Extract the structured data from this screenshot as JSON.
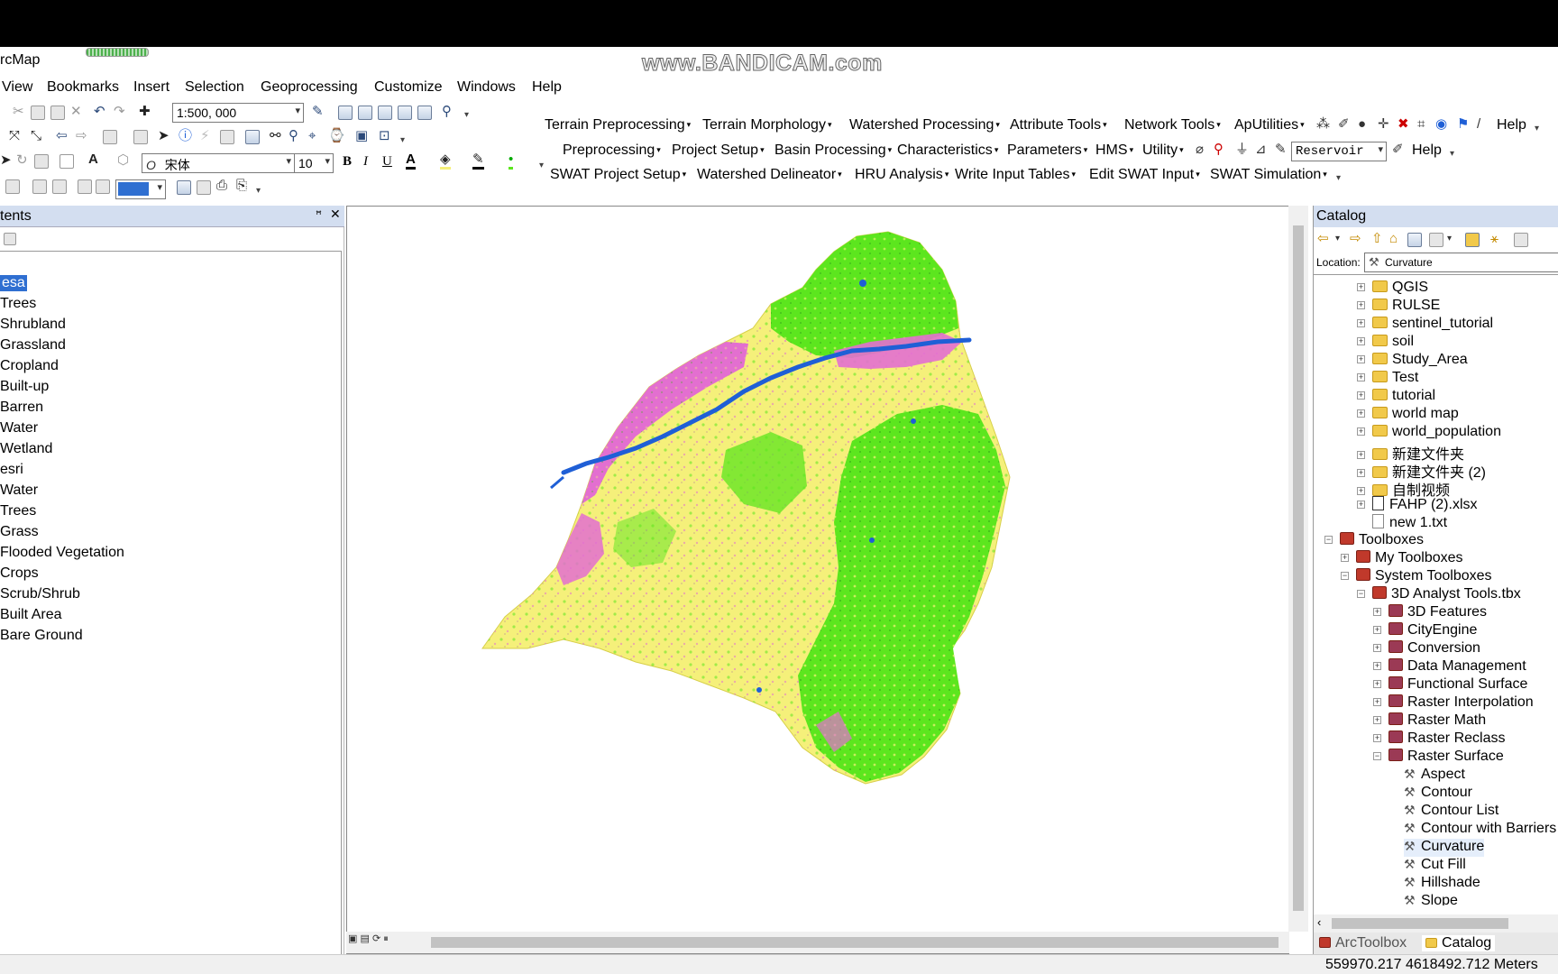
{
  "window": {
    "app_title": "rcMap",
    "watermark": "www.BANDICAM.com",
    "minimize_glyph": "—"
  },
  "menu": [
    "View",
    "Bookmarks",
    "Insert",
    "Selection",
    "Geoprocessing",
    "Customize",
    "Windows",
    "Help"
  ],
  "standard_toolbar": {
    "scale_value": "1:500, 000"
  },
  "font_toolbar": {
    "font_name": "宋体",
    "font_size": "10",
    "bold": "B",
    "italic": "I",
    "underline": "U",
    "font_color": "A"
  },
  "taudem_toolbar": {
    "items": [
      "Terrain Preprocessing",
      "Terrain Morphology",
      "Watershed Processing",
      "Attribute Tools",
      "Network Tools",
      "ApUtilities"
    ],
    "help": "Help"
  },
  "hms_toolbar": {
    "items": [
      "Preprocessing",
      "Project Setup",
      "Basin Processing",
      "Characteristics",
      "Parameters",
      "HMS",
      "Utility"
    ],
    "reservoir": "Reservoir",
    "help": "Help"
  },
  "swat_toolbar": {
    "items": [
      "SWAT Project Setup",
      "Watershed Delineator",
      "HRU Analysis",
      "Write Input Tables",
      "Edit SWAT Input",
      "SWAT Simulation"
    ]
  },
  "toc": {
    "title": "tents",
    "pin": "ꟸ",
    "close": "✕",
    "items": [
      "esa",
      "Trees",
      "Shrubland",
      "Grassland",
      "Cropland",
      "Built-up",
      "Barren",
      "Water",
      "Wetland",
      "esri",
      "Water",
      "Trees",
      "Grass",
      "Flooded Vegetation",
      "Crops",
      "Scrub/Shrub",
      "Built Area",
      "Bare Ground"
    ]
  },
  "map": {
    "colors": {
      "cropland": "#f5f07a",
      "trees": "#5ce61e",
      "built": "#e36fd0",
      "water": "#1f5fd6",
      "barren": "#c9a58a"
    }
  },
  "catalog": {
    "title": "Catalog",
    "location_label": "Location:",
    "location_value": "Curvature",
    "folders": [
      "QGIS",
      "RULSE",
      "sentinel_tutorial",
      "soil",
      "Study_Area",
      "Test",
      "tutorial",
      "world map",
      "world_population",
      "新建文件夹",
      "新建文件夹 (2)",
      "自制视频"
    ],
    "files": [
      "FAHP (2).xlsx",
      "new 1.txt"
    ],
    "toolboxes": "Toolboxes",
    "my_toolboxes": "My Toolboxes",
    "system_toolboxes": "System Toolboxes",
    "analyst_tbx": "3D Analyst Tools.tbx",
    "toolsets": [
      "3D Features",
      "CityEngine",
      "Conversion",
      "Data Management",
      "Functional Surface",
      "Raster Interpolation",
      "Raster Math",
      "Raster Reclass",
      "Raster Surface"
    ],
    "tools": [
      "Aspect",
      "Contour",
      "Contour List",
      "Contour with Barriers",
      "Curvature",
      "Cut Fill",
      "Hillshade",
      "Slope"
    ],
    "tab_arctoolbox": "ArcToolbox",
    "tab_catalog": "Catalog"
  },
  "status": {
    "coords": "559970.217  4618492.712 Meters"
  }
}
